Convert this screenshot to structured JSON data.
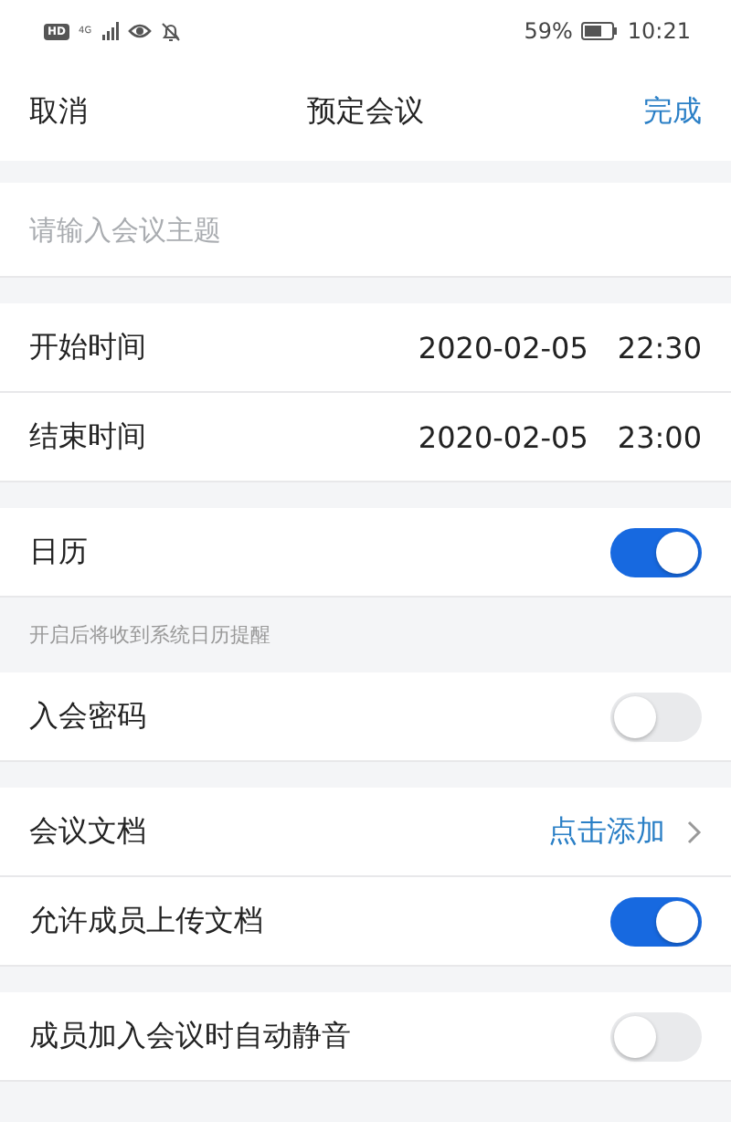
{
  "status_bar": {
    "hd_badge": "HD",
    "network": "4G",
    "battery": "59%",
    "time": "10:21"
  },
  "nav": {
    "cancel": "取消",
    "title": "预定会议",
    "done": "完成"
  },
  "topic": {
    "placeholder": "请输入会议主题"
  },
  "sections": [
    {
      "rows": [
        {
          "kind": "time",
          "label": "开始时间",
          "date": "2020-02-05",
          "time": "22:30"
        },
        {
          "kind": "time",
          "label": "结束时间",
          "date": "2020-02-05",
          "time": "23:00"
        }
      ]
    },
    {
      "rows": [
        {
          "kind": "toggle",
          "label": "日历",
          "on": true
        }
      ],
      "hint": "开启后将收到系统日历提醒"
    },
    {
      "rows": [
        {
          "kind": "toggle",
          "label": "入会密码",
          "on": false
        }
      ]
    },
    {
      "rows": [
        {
          "kind": "link",
          "label": "会议文档",
          "action": "点击添加"
        },
        {
          "kind": "toggle",
          "label": "允许成员上传文档",
          "on": true
        }
      ]
    },
    {
      "rows": [
        {
          "kind": "toggle",
          "label": "成员加入会议时自动静音",
          "on": false
        }
      ]
    }
  ]
}
